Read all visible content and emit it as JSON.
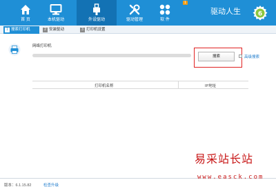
{
  "colors": {
    "brand": "#1f8fd6",
    "brand_dark": "#1372b4",
    "highlight_box": "#e02020",
    "link": "#1f7ccc",
    "badge": "#f39c12"
  },
  "nav": [
    {
      "label": "首 页",
      "icon": "home-icon"
    },
    {
      "label": "本机驱动",
      "icon": "monitor-icon"
    },
    {
      "label": "外设驱动",
      "icon": "usb-icon"
    },
    {
      "label": "驱动管理",
      "icon": "wrench-icon"
    },
    {
      "label": "软 件",
      "icon": "apps-icon"
    }
  ],
  "nav_badge": "1",
  "app_title": "驱动人生",
  "tabs": [
    {
      "num": "1",
      "label": "搜索打印机"
    },
    {
      "num": "2",
      "label": "安装驱动"
    },
    {
      "num": "3",
      "label": "打印机设置"
    }
  ],
  "network_printer_label": "网络打印机",
  "search_progress": 0,
  "search_button": "搜索",
  "advanced_search": "高级搜索",
  "table": {
    "col_name": "打印机名称",
    "col_ip": "IP地址"
  },
  "footer": {
    "version": "版本：6.1.15.82",
    "check_update": "检查升级"
  },
  "watermark": {
    "title": "易采站长站",
    "url": "www.easck.com"
  }
}
